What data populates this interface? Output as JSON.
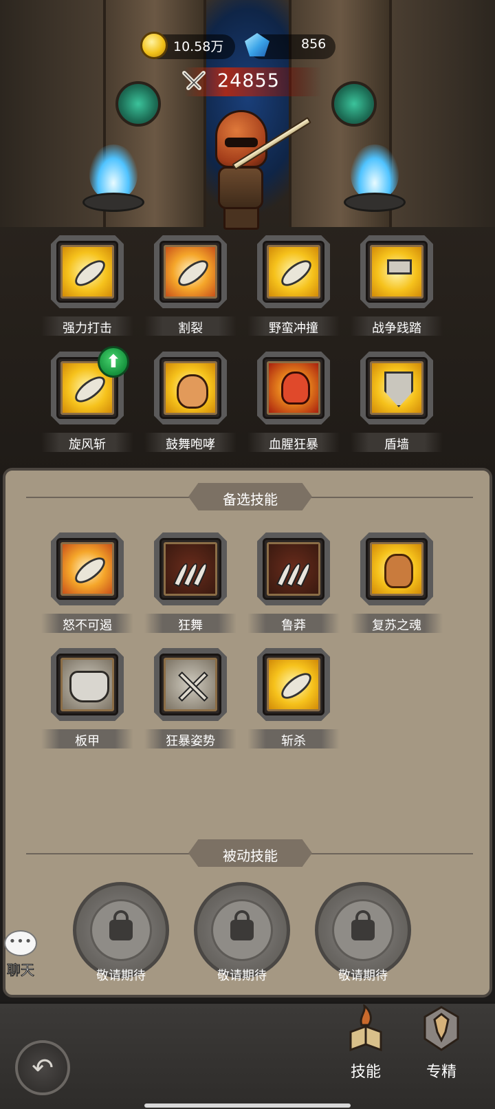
{
  "currency": {
    "gold": "10.58万",
    "gems": "856"
  },
  "power": "24855",
  "equipped_skills": [
    {
      "name": "强力打击",
      "icon": "power-strike-icon",
      "theme": "art-yellow",
      "shape": "blade"
    },
    {
      "name": "割裂",
      "icon": "rend-icon",
      "theme": "art-orange",
      "shape": "blade"
    },
    {
      "name": "野蛮冲撞",
      "icon": "savage-charge-icon",
      "theme": "art-yellow",
      "shape": "blade"
    },
    {
      "name": "战争践踏",
      "icon": "war-stomp-icon",
      "theme": "art-yellow",
      "shape": "hammer"
    },
    {
      "name": "旋风斩",
      "icon": "whirlwind-icon",
      "theme": "art-yellow",
      "shape": "blade"
    },
    {
      "name": "鼓舞咆哮",
      "icon": "inspiring-shout-icon",
      "theme": "art-yellow",
      "shape": "face"
    },
    {
      "name": "血腥狂暴",
      "icon": "blood-rage-icon",
      "theme": "art-red",
      "shape": "skull"
    },
    {
      "name": "盾墙",
      "icon": "shield-wall-icon",
      "theme": "art-yellow",
      "shape": "shield"
    }
  ],
  "alternate_section": {
    "title": "备选技能"
  },
  "alternate_skills": [
    {
      "name": "怒不可遏",
      "icon": "unstoppable-rage-icon",
      "theme": "art-orange",
      "shape": "blade"
    },
    {
      "name": "狂舞",
      "icon": "frenzy-dance-icon",
      "theme": "art-dark",
      "shape": "claw"
    },
    {
      "name": "鲁莽",
      "icon": "recklessness-icon",
      "theme": "art-dark",
      "shape": "claw"
    },
    {
      "name": "复苏之魂",
      "icon": "reviving-soul-icon",
      "theme": "art-yellow",
      "shape": "muscle"
    },
    {
      "name": "板甲",
      "icon": "plate-armor-icon",
      "theme": "art-gray",
      "shape": "armor"
    },
    {
      "name": "狂暴姿势",
      "icon": "berserker-stance-icon",
      "theme": "art-gray",
      "shape": "swords"
    },
    {
      "name": "斩杀",
      "icon": "execute-icon",
      "theme": "art-yellow",
      "shape": "blade"
    }
  ],
  "passive_section": {
    "title": "被动技能"
  },
  "passive_slots": [
    {
      "label": "敬请期待"
    },
    {
      "label": "敬请期待"
    },
    {
      "label": "敬请期待"
    }
  ],
  "chat": {
    "dots": "•••",
    "label": "聊天"
  },
  "back": {
    "glyph": "↶"
  },
  "upgrade": {
    "glyph": "⬆"
  },
  "tabs": [
    {
      "label": "技能",
      "icon": "skill-book-icon",
      "active": true
    },
    {
      "label": "专精",
      "icon": "specialization-icon",
      "active": false
    }
  ]
}
